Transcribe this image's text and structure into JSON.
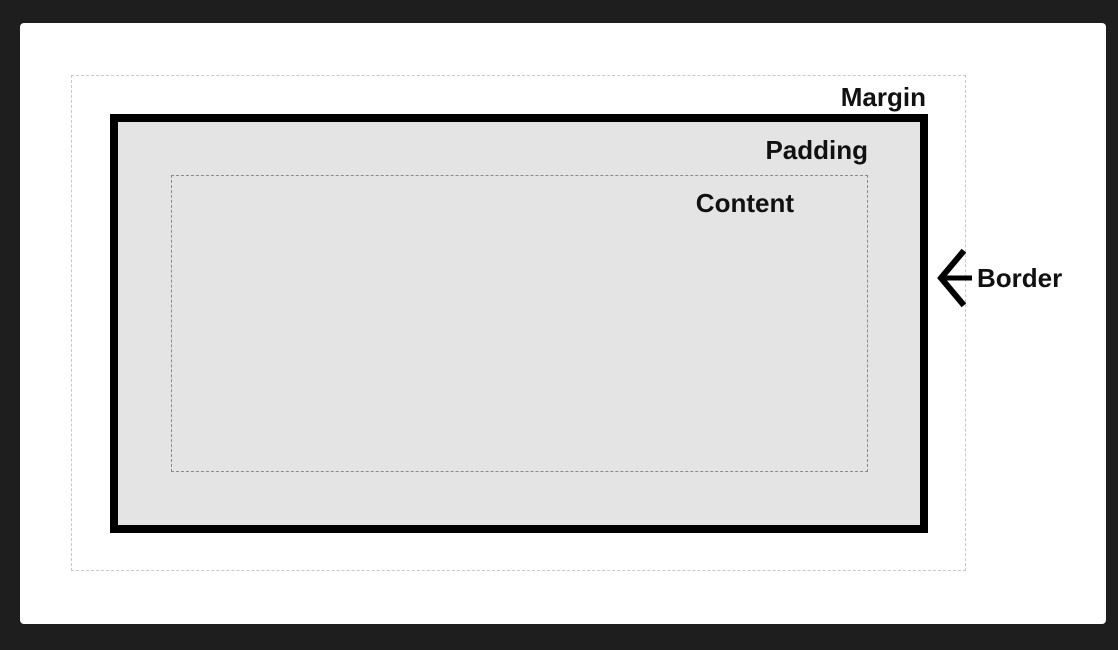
{
  "diagram": {
    "labels": {
      "margin": "Margin",
      "padding": "Padding",
      "content": "Content",
      "border": "Border"
    },
    "icons": {
      "border_pointer": "arrow-left-icon"
    },
    "colors": {
      "page_background": "#1e1e1e",
      "canvas_background": "#ffffff",
      "border_color": "#000000",
      "padding_fill": "#e4e4e4",
      "margin_outline": "#c8c8c8",
      "content_outline": "#8a8a8a"
    }
  }
}
